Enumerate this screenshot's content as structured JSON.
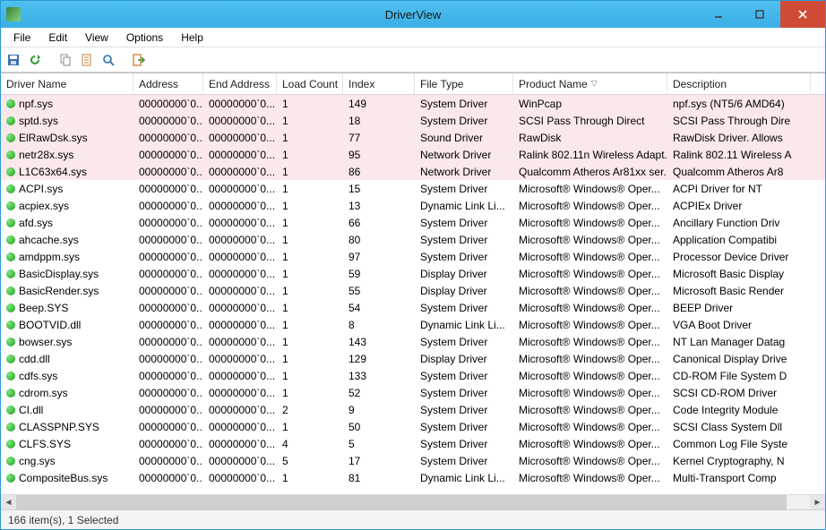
{
  "window": {
    "title": "DriverView"
  },
  "menu": {
    "file": "File",
    "edit": "Edit",
    "view": "View",
    "options": "Options",
    "help": "Help"
  },
  "columns": [
    "Driver Name",
    "Address",
    "End Address",
    "Load Count",
    "Index",
    "File Type",
    "Product Name",
    "Description"
  ],
  "sort_column": "Product Name",
  "status": "166 item(s), 1 Selected",
  "rows": [
    {
      "hl": true,
      "name": "npf.sys",
      "addr": "00000000`0...",
      "end": "00000000`0...",
      "load": "1",
      "idx": "149",
      "ftype": "System Driver",
      "prod": "WinPcap",
      "desc": "npf.sys (NT5/6 AMD64)"
    },
    {
      "hl": true,
      "name": "sptd.sys",
      "addr": "00000000`0...",
      "end": "00000000`0...",
      "load": "1",
      "idx": "18",
      "ftype": "System Driver",
      "prod": "SCSI Pass Through Direct",
      "desc": "SCSI Pass Through Dire"
    },
    {
      "hl": true,
      "name": "ElRawDsk.sys",
      "addr": "00000000`0...",
      "end": "00000000`0...",
      "load": "1",
      "idx": "77",
      "ftype": "Sound Driver",
      "prod": "RawDisk",
      "desc": "RawDisk Driver. Allows"
    },
    {
      "hl": true,
      "name": "netr28x.sys",
      "addr": "00000000`0...",
      "end": "00000000`0...",
      "load": "1",
      "idx": "95",
      "ftype": "Network Driver",
      "prod": "Ralink 802.11n Wireless Adapt...",
      "desc": "Ralink 802.11 Wireless A"
    },
    {
      "hl": true,
      "name": "L1C63x64.sys",
      "addr": "00000000`0...",
      "end": "00000000`0...",
      "load": "1",
      "idx": "86",
      "ftype": "Network Driver",
      "prod": "Qualcomm Atheros Ar81xx ser...",
      "desc": "Qualcomm Atheros Ar8"
    },
    {
      "hl": false,
      "name": "ACPI.sys",
      "addr": "00000000`0...",
      "end": "00000000`0...",
      "load": "1",
      "idx": "15",
      "ftype": "System Driver",
      "prod": "Microsoft® Windows® Oper...",
      "desc": "ACPI Driver for NT"
    },
    {
      "hl": false,
      "name": "acpiex.sys",
      "addr": "00000000`0...",
      "end": "00000000`0...",
      "load": "1",
      "idx": "13",
      "ftype": "Dynamic Link Li...",
      "prod": "Microsoft® Windows® Oper...",
      "desc": "ACPIEx Driver"
    },
    {
      "hl": false,
      "name": "afd.sys",
      "addr": "00000000`0...",
      "end": "00000000`0...",
      "load": "1",
      "idx": "66",
      "ftype": "System Driver",
      "prod": "Microsoft® Windows® Oper...",
      "desc": "Ancillary Function Driv"
    },
    {
      "hl": false,
      "name": "ahcache.sys",
      "addr": "00000000`0...",
      "end": "00000000`0...",
      "load": "1",
      "idx": "80",
      "ftype": "System Driver",
      "prod": "Microsoft® Windows® Oper...",
      "desc": "Application Compatibi"
    },
    {
      "hl": false,
      "name": "amdppm.sys",
      "addr": "00000000`0...",
      "end": "00000000`0...",
      "load": "1",
      "idx": "97",
      "ftype": "System Driver",
      "prod": "Microsoft® Windows® Oper...",
      "desc": "Processor Device Driver"
    },
    {
      "hl": false,
      "name": "BasicDisplay.sys",
      "addr": "00000000`0...",
      "end": "00000000`0...",
      "load": "1",
      "idx": "59",
      "ftype": "Display Driver",
      "prod": "Microsoft® Windows® Oper...",
      "desc": "Microsoft Basic Display"
    },
    {
      "hl": false,
      "name": "BasicRender.sys",
      "addr": "00000000`0...",
      "end": "00000000`0...",
      "load": "1",
      "idx": "55",
      "ftype": "Display Driver",
      "prod": "Microsoft® Windows® Oper...",
      "desc": "Microsoft Basic Render"
    },
    {
      "hl": false,
      "name": "Beep.SYS",
      "addr": "00000000`0...",
      "end": "00000000`0...",
      "load": "1",
      "idx": "54",
      "ftype": "System Driver",
      "prod": "Microsoft® Windows® Oper...",
      "desc": "BEEP Driver"
    },
    {
      "hl": false,
      "name": "BOOTVID.dll",
      "addr": "00000000`0...",
      "end": "00000000`0...",
      "load": "1",
      "idx": "8",
      "ftype": "Dynamic Link Li...",
      "prod": "Microsoft® Windows® Oper...",
      "desc": "VGA Boot Driver"
    },
    {
      "hl": false,
      "name": "bowser.sys",
      "addr": "00000000`0...",
      "end": "00000000`0...",
      "load": "1",
      "idx": "143",
      "ftype": "System Driver",
      "prod": "Microsoft® Windows® Oper...",
      "desc": "NT Lan Manager Datag"
    },
    {
      "hl": false,
      "name": "cdd.dll",
      "addr": "00000000`0...",
      "end": "00000000`0...",
      "load": "1",
      "idx": "129",
      "ftype": "Display Driver",
      "prod": "Microsoft® Windows® Oper...",
      "desc": "Canonical Display Drive"
    },
    {
      "hl": false,
      "name": "cdfs.sys",
      "addr": "00000000`0...",
      "end": "00000000`0...",
      "load": "1",
      "idx": "133",
      "ftype": "System Driver",
      "prod": "Microsoft® Windows® Oper...",
      "desc": "CD-ROM File System D"
    },
    {
      "hl": false,
      "name": "cdrom.sys",
      "addr": "00000000`0...",
      "end": "00000000`0...",
      "load": "1",
      "idx": "52",
      "ftype": "System Driver",
      "prod": "Microsoft® Windows® Oper...",
      "desc": "SCSI CD-ROM Driver"
    },
    {
      "hl": false,
      "name": "CI.dll",
      "addr": "00000000`0...",
      "end": "00000000`0...",
      "load": "2",
      "idx": "9",
      "ftype": "System Driver",
      "prod": "Microsoft® Windows® Oper...",
      "desc": "Code Integrity Module"
    },
    {
      "hl": false,
      "name": "CLASSPNP.SYS",
      "addr": "00000000`0...",
      "end": "00000000`0...",
      "load": "1",
      "idx": "50",
      "ftype": "System Driver",
      "prod": "Microsoft® Windows® Oper...",
      "desc": "SCSI Class System Dll"
    },
    {
      "hl": false,
      "name": "CLFS.SYS",
      "addr": "00000000`0...",
      "end": "00000000`0...",
      "load": "4",
      "idx": "5",
      "ftype": "System Driver",
      "prod": "Microsoft® Windows® Oper...",
      "desc": "Common Log File Syste"
    },
    {
      "hl": false,
      "name": "cng.sys",
      "addr": "00000000`0...",
      "end": "00000000`0...",
      "load": "5",
      "idx": "17",
      "ftype": "System Driver",
      "prod": "Microsoft® Windows® Oper...",
      "desc": "Kernel Cryptography, N"
    },
    {
      "hl": false,
      "name": "CompositeBus.sys",
      "addr": "00000000`0...",
      "end": "00000000`0...",
      "load": "1",
      "idx": "81",
      "ftype": "Dynamic Link Li...",
      "prod": "Microsoft® Windows® Oper...",
      "desc": "Multi-Transport Comp"
    }
  ]
}
